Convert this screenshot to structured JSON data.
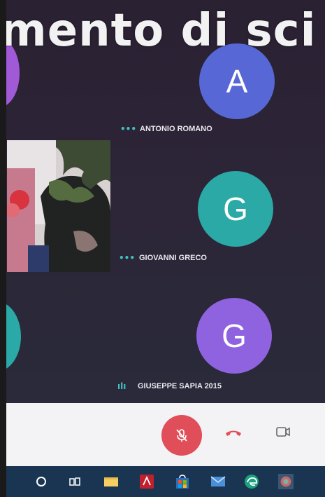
{
  "caption": {
    "text": "mento di sci"
  },
  "participants": [
    {
      "initial": "A",
      "name": "ANTONIO ROMANO",
      "color": "#5867d6"
    },
    {
      "initial": "G",
      "name": "GIOVANNI GRECO",
      "color": "#2aa9a6"
    },
    {
      "initial": "G",
      "name": "GIUSEPPE SAPIA 2015",
      "color": "#8f62df"
    }
  ],
  "controls": {
    "mic": {
      "icon": "mic-off-icon",
      "color": "#e04e5a"
    },
    "hangup": {
      "icon": "phone-hangup-icon",
      "color": "#e04e5a"
    },
    "camera": {
      "icon": "camera-icon"
    }
  },
  "taskbar": {
    "icons": [
      "cortana-icon",
      "task-view-icon",
      "file-explorer-icon",
      "adobe-reader-icon",
      "store-icon",
      "mail-icon",
      "edge-icon",
      "app-icon"
    ]
  }
}
